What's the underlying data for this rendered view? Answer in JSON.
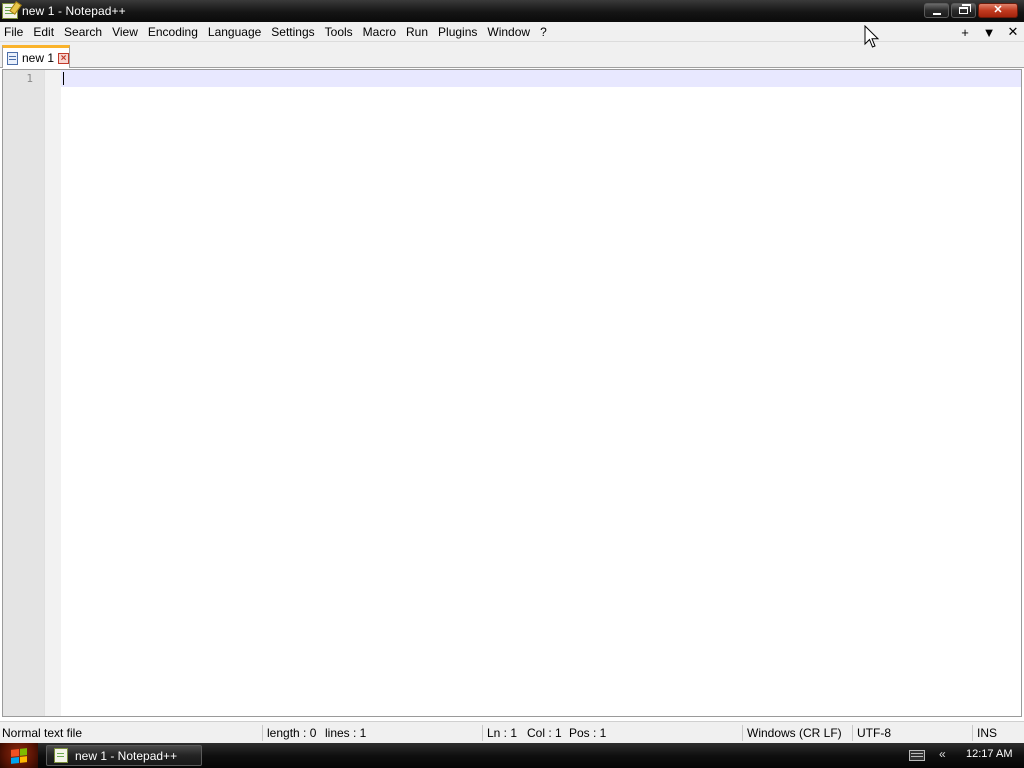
{
  "window": {
    "title": "new 1 - Notepad++",
    "controls": {
      "minimize": "minimize",
      "restore": "restore",
      "close": "close"
    }
  },
  "menu": {
    "items": [
      "File",
      "Edit",
      "Search",
      "View",
      "Encoding",
      "Language",
      "Settings",
      "Tools",
      "Macro",
      "Run",
      "Plugins",
      "Window",
      "?"
    ],
    "right": {
      "plus": "+",
      "dropdown": "▼",
      "close": "✕"
    }
  },
  "tabs": [
    {
      "label": "new 1",
      "active": true
    }
  ],
  "editor": {
    "line_numbers": [
      "1"
    ],
    "current_line_color": "#e8e8ff"
  },
  "status": {
    "file_type": "Normal text file",
    "length": "length : 0",
    "lines": "lines : 1",
    "ln": "Ln : 1",
    "col": "Col : 1",
    "pos": "Pos : 1",
    "eol": "Windows (CR LF)",
    "encoding": "UTF-8",
    "mode": "INS"
  },
  "taskbar": {
    "task_label": "new 1 - Notepad++",
    "tray_chevron": "«",
    "clock": "12:17 AM"
  },
  "colors": {
    "tab_accent": "#fab32c",
    "close_button": "#c13a1f"
  }
}
